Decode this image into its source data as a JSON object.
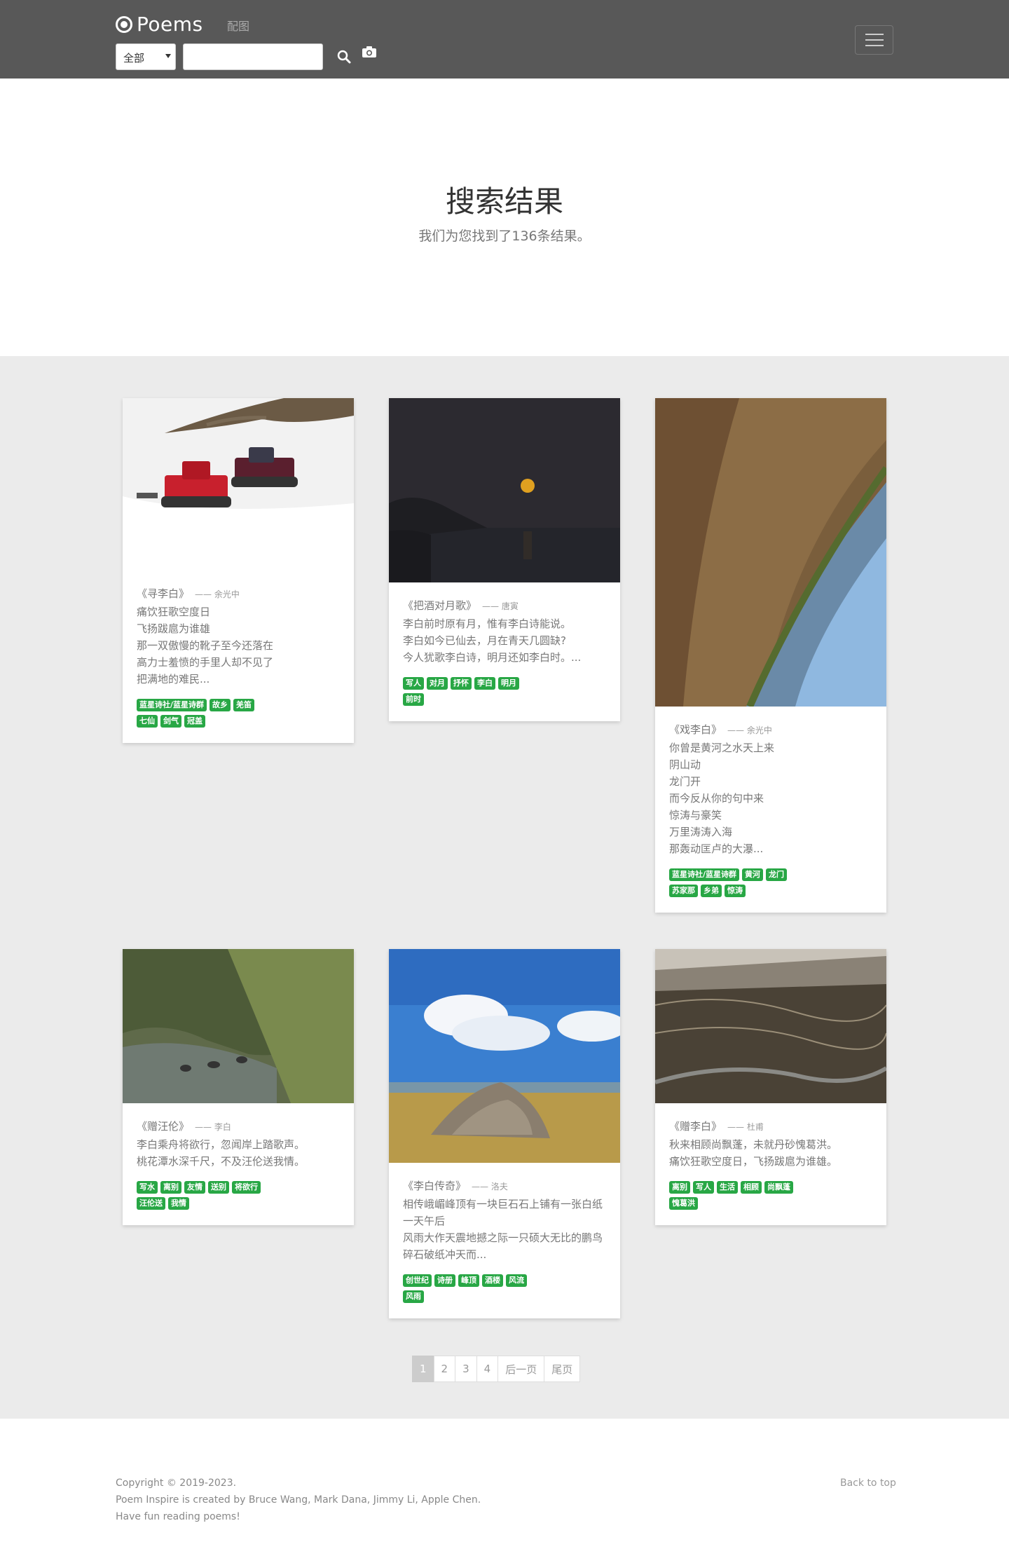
{
  "navbar": {
    "brand": "Poems",
    "link": "配图",
    "select_value": "全部",
    "search_value": ""
  },
  "hero": {
    "title": "搜索结果",
    "subtitle": "我们为您找到了136条结果。"
  },
  "cards": [
    {
      "title": "《寻李白》",
      "author": "—— 余光中",
      "text": "痛饮狂歌空度日\n飞扬跋扈为谁雄\n那一双傲慢的靴子至今还落在\n高力士羞愤的手里人却不见了\n把满地的难民...",
      "tags": [
        "蓝星诗社/蓝星诗群",
        "故乡",
        "羌笛",
        "七仙",
        "剑气",
        "冠盖"
      ]
    },
    {
      "title": "《把酒对月歌》",
      "author": "—— 唐寅",
      "text": "李白前时原有月，惟有李白诗能说。\n李白如今已仙去，月在青天几圆缺?\n今人犹歌李白诗，明月还如李白时。...",
      "tags": [
        "写人",
        "对月",
        "抒怀",
        "李白",
        "明月",
        "前时"
      ]
    },
    {
      "title": "《戏李白》",
      "author": "—— 余光中",
      "text": "你曾是黄河之水天上来\n阴山动\n龙门开\n而今反从你的句中来\n惊涛与豪笑\n万里涛涛入海\n那轰动匡卢的大瀑...",
      "tags": [
        "蓝星诗社/蓝星诗群",
        "黄河",
        "龙门",
        "苏家那",
        "乡弟",
        "惊涛"
      ]
    },
    {
      "title": "《赠汪伦》",
      "author": "—— 李白",
      "text": "李白乘舟将欲行，忽闻岸上踏歌声。\n桃花潭水深千尺，不及汪伦送我情。",
      "tags": [
        "写水",
        "离别",
        "友情",
        "送别",
        "将欲行",
        "汪伦送",
        "我情"
      ]
    },
    {
      "title": "《李白传奇》",
      "author": "—— 洛夫",
      "text": "相传峨嵋峰顶有一块巨石石上铺有一张白纸一天午后\n风雨大作天震地撼之际一只硕大无比的鹏鸟碎石破纸冲天而...",
      "tags": [
        "创世纪",
        "诗册",
        "峰顶",
        "酒楼",
        "风流",
        "风雨"
      ]
    },
    {
      "title": "《赠李白》",
      "author": "—— 杜甫",
      "text": "秋来相顾尚飘蓬，未就丹砂愧葛洪。\n痛饮狂歌空度日，飞扬跋扈为谁雄。",
      "tags": [
        "离别",
        "写人",
        "生活",
        "相顾",
        "尚飘蓬",
        "愧葛洪"
      ]
    }
  ],
  "pagination": {
    "pages": [
      "1",
      "2",
      "3",
      "4",
      "后一页",
      "尾页"
    ],
    "active": "1"
  },
  "footer": {
    "copyright": "Copyright © 2019-2023.",
    "credits": "Poem Inspire is created by Bruce Wang, Mark Dana, Jimmy Li, Apple Chen.",
    "tagline": "Have fun reading poems!",
    "back_to_top": "Back to top"
  },
  "colors": {
    "navbar": "#585858",
    "album_bg": "#ebebeb",
    "tag": "#28a745"
  },
  "icons": [
    "brand-icon",
    "search-icon",
    "camera-icon",
    "menu-icon"
  ]
}
